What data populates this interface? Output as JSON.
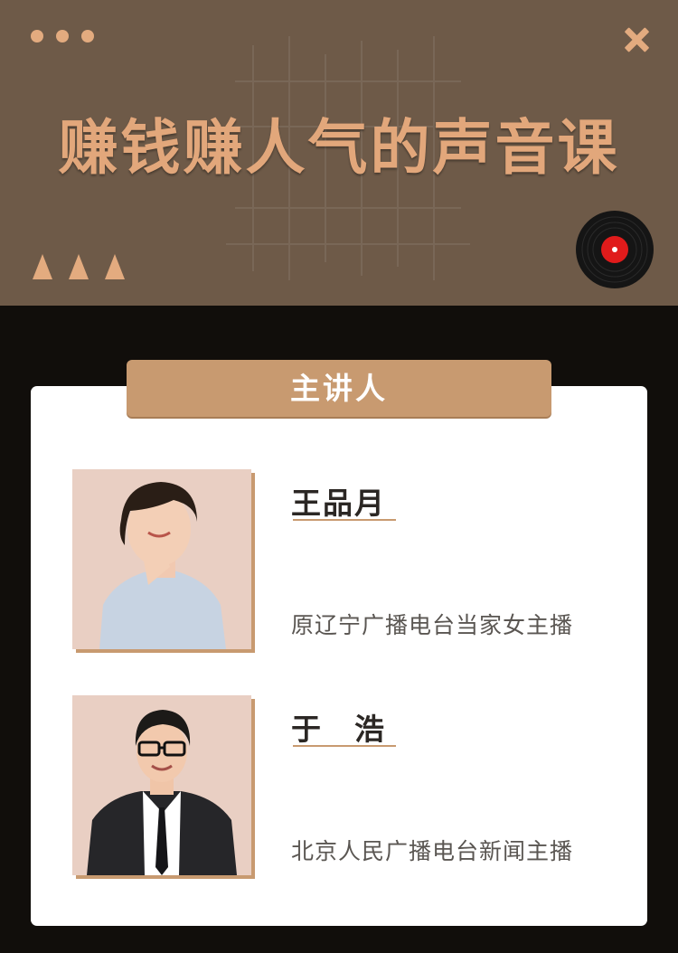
{
  "header": {
    "title": "赚钱赚人气的声音课",
    "menu_icon": "more-dots-icon",
    "close_icon": "close-icon",
    "vinyl_icon": "vinyl-record-icon",
    "accent_color": "#e3ab7f",
    "background_color": "#6e5a48"
  },
  "section": {
    "label": "主讲人"
  },
  "speakers": [
    {
      "name": "王品月",
      "description": "原辽宁广播电台当家女主播"
    },
    {
      "name": "于　浩",
      "description": "北京人民广播电台新闻主播"
    }
  ]
}
